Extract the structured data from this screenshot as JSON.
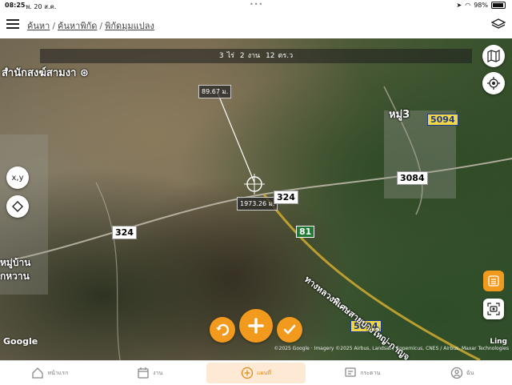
{
  "status_bar": {
    "time": "08:25",
    "date": "พ. 20 ส.ค.",
    "battery": "98%"
  },
  "header": {
    "breadcrumb": [
      "ค้นหา",
      "ค้นหาพิกัด",
      "พิกัดมุมแปลง"
    ],
    "menu_icon": "hamburger-icon",
    "layers_icon": "layers-icon"
  },
  "area": {
    "rai": "3",
    "rai_unit": "ไร่",
    "ngan": "2",
    "ngan_unit": "งาน",
    "wa": "12",
    "wa_unit": "ตร.ว"
  },
  "measurements": {
    "distance_top": "89.67 ม.",
    "distance_center": "1973.26 ม."
  },
  "map_labels": {
    "place_topleft": "สำนักสงฆ์สามงา",
    "place_right": "หมู่3",
    "place_left_line1": "หมู่บ้าน",
    "place_left_line2": "กหวาน",
    "road_324_a": "324",
    "road_324_b": "324",
    "road_3084": "3084",
    "hwy_5094_a": "5094",
    "hwy_5094_b": "5094",
    "road_81": "81",
    "expressway": "ทางหลวงพิเศษสายบางใหญ่-กาญจ"
  },
  "map_controls": {
    "xy_label": "x,y"
  },
  "attribution": {
    "google": "Google",
    "imagery": "©2025 Google · Imagery ©2025 Airbus, Landsat / Copernicus, CNES / Airbus, Maxar Technologies",
    "ling": "Ling"
  },
  "tabs": [
    {
      "label": "หน้าแรก",
      "icon": "home-icon"
    },
    {
      "label": "งาน",
      "icon": "calendar-icon"
    },
    {
      "label": "แผนที่",
      "icon": "plus-circle-icon",
      "active": true
    },
    {
      "label": "กระดาน",
      "icon": "message-icon"
    },
    {
      "label": "ฉัน",
      "icon": "user-icon"
    }
  ]
}
